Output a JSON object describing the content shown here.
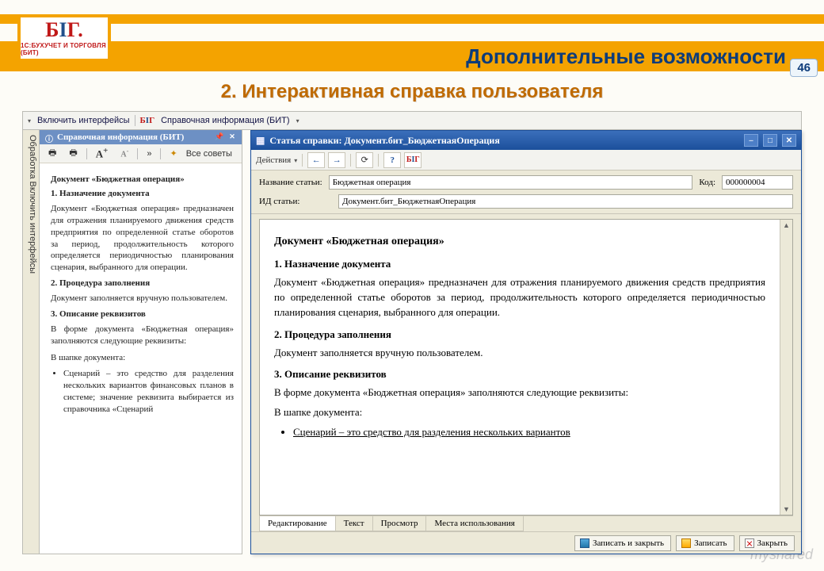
{
  "slide": {
    "logo_main": "БІГ.",
    "logo_sub": "1С:БУХУЧЕТ И ТОРГОВЛЯ (БИТ)",
    "title": "Дополнительные возможности",
    "subtitle": "2.  Интерактивная справка пользователя",
    "page": "46",
    "watermark": "myshared"
  },
  "menubar": {
    "include": "Включить интерфейсы",
    "tab": "Справочная информация (БИТ)"
  },
  "sidetab": "Обработка  Включить интерфейсы",
  "help": {
    "title": "Справочная информация (БИТ)",
    "fontA": "A",
    "fontA2": "A",
    "all_tips": "Все советы",
    "dquote": "»",
    "h1": "Документ «Бюджетная операция»",
    "n1": "1.   Назначение документа",
    "p1": "Документ «Бюджетная операция» предназначен для отражения планируемого движения средств предприятия по определенной статье оборотов за период, продолжительность которого определяется периодичностью планирования сценария, выбранного для операции.",
    "n2": "2.   Процедура заполнения",
    "p2": "Документ заполняется вручную пользователем.",
    "n3": "3.   Описание реквизитов",
    "p3": "В форме документа «Бюджетная операция» заполняются следующие реквизиты:",
    "p4": "В шапке документа:",
    "li1": "Сценарий – это средство для разделения нескольких вариантов финансовых планов в системе; значение реквизита выбирается из справочника «Сценарий"
  },
  "article": {
    "title": "Статья справки: Документ.бит_БюджетнаяОперация",
    "actions": "Действия",
    "lbl_name": "Название статьи:",
    "val_name": "Бюджетная операция",
    "lbl_kod": "Код:",
    "val_kod": "000000004",
    "lbl_id": "ИД статьи:",
    "val_id": "Документ.бит_БюджетнаяОперация",
    "tabs": {
      "edit": "Редактирование",
      "text": "Текст",
      "view": "Просмотр",
      "use": "Места использования"
    },
    "btn_save_close": "Записать и закрыть",
    "btn_save": "Записать",
    "btn_close": "Закрыть",
    "doc": {
      "h": "Документ «Бюджетная операция»",
      "n1": "1.   Назначение документа",
      "p1": "Документ «Бюджетная операция» предназначен для отражения планируемого движения средств предприятия по определенной статье оборотов за период, продолжительность которого определяется периодичностью планирования сценария, выбранного для операции.",
      "n2": "2.   Процедура заполнения",
      "p2": "Документ заполняется вручную пользователем.",
      "n3": "3.   Описание реквизитов",
      "p3": "В форме документа «Бюджетная операция» заполняются следующие реквизиты:",
      "p4": "В шапке документа:",
      "li1": "Сценарий – это средство для разделения нескольких вариантов"
    }
  }
}
